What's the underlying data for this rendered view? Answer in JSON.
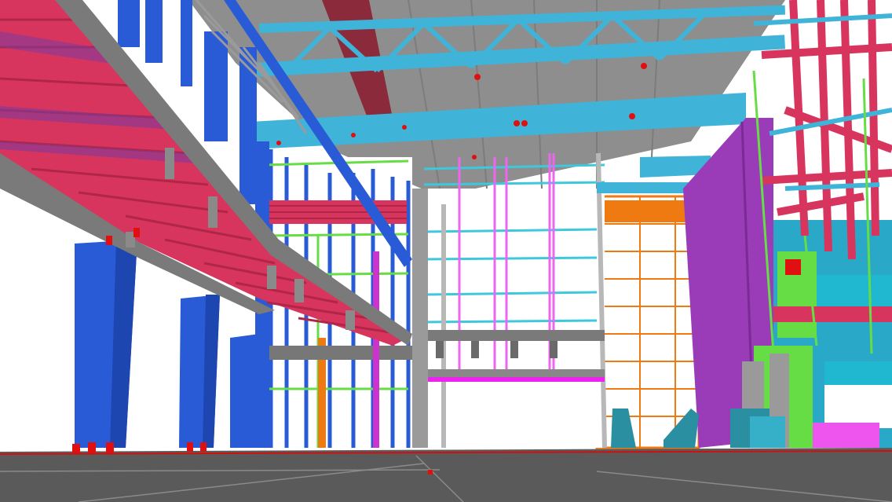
{
  "scene": {
    "kind": "3d-bim-model-viewport",
    "colors": {
      "background": "#ffffff",
      "floor": "#5a5a5a",
      "ceiling": "#8e8e8e",
      "column_blue": "#2a5bd7",
      "stair_red": "#d8355e",
      "stair_dark": "#b02647",
      "truss_cyan": "#3fb4d8",
      "beam_grey": "#6f6f6f",
      "wall_purple": "#9a3bb8",
      "frame_orange": "#f07a12",
      "green": "#66dd44",
      "magenta": "#ee33ee",
      "teal_equipment": "#2a8fa0",
      "accent_red": "#e01010"
    }
  }
}
